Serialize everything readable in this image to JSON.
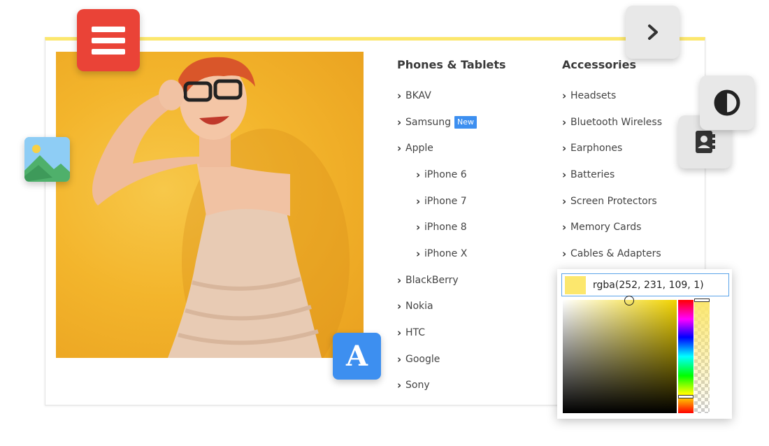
{
  "panel": {
    "accent_color": "#fce76d"
  },
  "columns": {
    "phones": {
      "title": "Phones & Tablets",
      "items": [
        {
          "label": "BKAV"
        },
        {
          "label": "Samsung",
          "badge": "New"
        },
        {
          "label": "Apple"
        },
        {
          "label": "iPhone 6",
          "sub": true
        },
        {
          "label": "iPhone 7",
          "sub": true
        },
        {
          "label": "iPhone 8",
          "sub": true
        },
        {
          "label": "iPhone X",
          "sub": true
        },
        {
          "label": "BlackBerry"
        },
        {
          "label": "Nokia"
        },
        {
          "label": "HTC"
        },
        {
          "label": "Google"
        },
        {
          "label": "Sony"
        }
      ]
    },
    "accessories": {
      "title": "Accessories",
      "items": [
        {
          "label": "Headsets"
        },
        {
          "label": "Bluetooth Wireless"
        },
        {
          "label": "Earphones"
        },
        {
          "label": "Batteries"
        },
        {
          "label": "Screen Protectors"
        },
        {
          "label": "Memory Cards"
        },
        {
          "label": "Cables & Adapters"
        }
      ]
    }
  },
  "tools": {
    "menu_icon": "hamburger-menu-icon",
    "next_icon": "chevron-right-icon",
    "contrast_icon": "contrast-icon",
    "contact_icon": "contact-book-icon",
    "image_icon": "image-icon",
    "font_letter": "A"
  },
  "color_picker": {
    "value": "rgba(252, 231, 109, 1)",
    "swatch_color": "#fce76d"
  },
  "colors": {
    "menu_button": "#ea4337",
    "badge": "#3d8ff0",
    "font_button": "#3d8ff0"
  }
}
